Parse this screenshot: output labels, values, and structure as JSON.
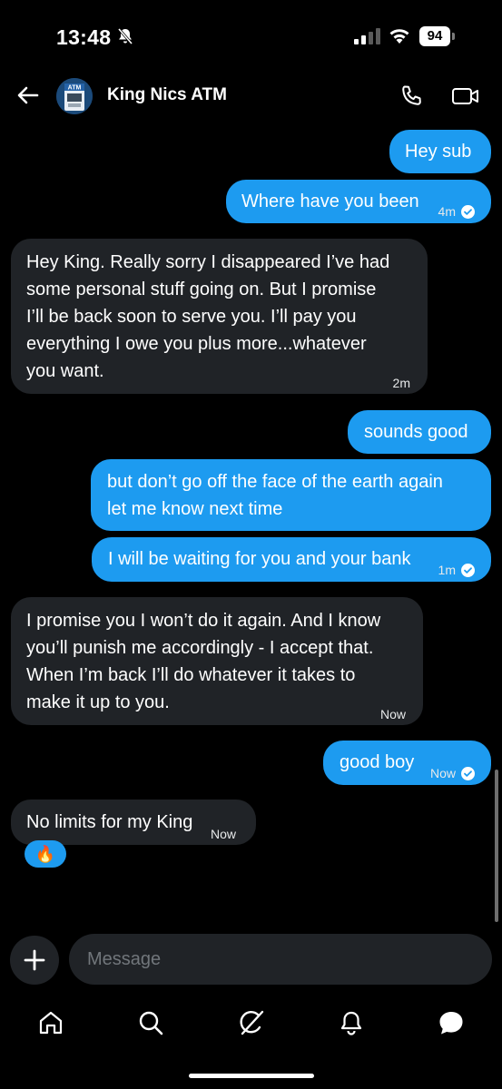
{
  "status_bar": {
    "time": "13:48",
    "battery": "94",
    "icons": [
      "bell-slash-icon",
      "signal-icon",
      "wifi-icon",
      "battery-icon"
    ]
  },
  "header": {
    "contact_name": "King Nics ATM",
    "avatar_label": "ATM",
    "icons": [
      "back-arrow-icon",
      "phone-icon",
      "video-icon"
    ]
  },
  "messages": [
    {
      "direction": "sent",
      "text": "Hey sub",
      "time": ""
    },
    {
      "direction": "sent",
      "text": "Where have you been",
      "time": "4m",
      "seen": true
    },
    {
      "direction": "received",
      "lines": [
        "Hey King. Really sorry I disappeared I’ve had",
        "some personal stuff going on. But I promise",
        "I’ll be back soon to serve you. I’ll pay you",
        "everything I owe you plus more...whatever",
        "you want."
      ],
      "time": "2m"
    },
    {
      "direction": "sent",
      "text": "sounds good",
      "time": ""
    },
    {
      "direction": "sent",
      "lines": [
        "but don’t go off the face of the earth again",
        "let me know next time"
      ],
      "time": ""
    },
    {
      "direction": "sent",
      "text": "I will be waiting for you and your bank",
      "time": "1m",
      "seen": true
    },
    {
      "direction": "received",
      "lines": [
        "I promise you I won’t do it again. And I know",
        "you’ll punish me accordingly - I accept that.",
        "When I’m back I’ll do whatever it takes to",
        "make it up to you."
      ],
      "time": "Now"
    },
    {
      "direction": "sent",
      "text": "good boy",
      "time": "Now",
      "seen": true
    },
    {
      "direction": "received",
      "text": "No limits for my King",
      "time": "Now",
      "reaction": "🔥"
    }
  ],
  "composer": {
    "placeholder": "Message"
  },
  "tabbar": {
    "items": [
      "home-icon",
      "search-icon",
      "grok-icon",
      "notifications-icon",
      "messages-icon"
    ],
    "active": "messages-icon"
  },
  "colors": {
    "accent": "#1d9bf0",
    "received_bubble": "#202327",
    "background": "#000000"
  }
}
